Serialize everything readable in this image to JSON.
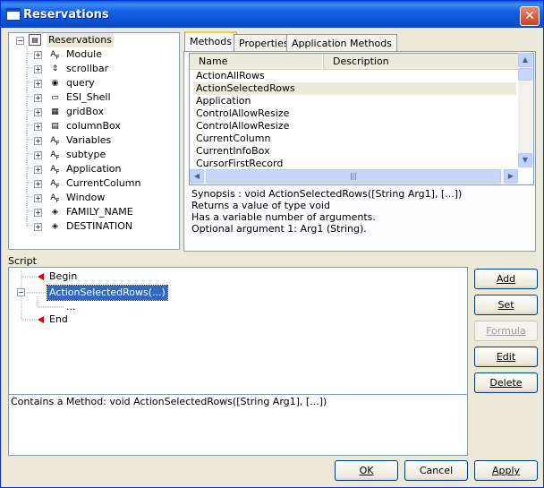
{
  "window": {
    "title": "Reservations",
    "close_glyph": "✕"
  },
  "tree": {
    "root": "Reservations",
    "items": [
      {
        "label": "Module",
        "icon": "af-icon"
      },
      {
        "label": "scrollbar",
        "icon": "scrollbar-icon"
      },
      {
        "label": "query",
        "icon": "query-icon"
      },
      {
        "label": "ESI_Shell",
        "icon": "shell-icon"
      },
      {
        "label": "gridBox",
        "icon": "grid-icon"
      },
      {
        "label": "columnBox",
        "icon": "column-icon"
      },
      {
        "label": "Variables",
        "icon": "af-icon"
      },
      {
        "label": "subtype",
        "icon": "af-icon"
      },
      {
        "label": "Application",
        "icon": "af-icon"
      },
      {
        "label": "CurrentColumn",
        "icon": "af-icon"
      },
      {
        "label": "Window",
        "icon": "af-icon"
      },
      {
        "label": "FAMILY_NAME",
        "icon": "field-icon"
      },
      {
        "label": "DESTINATION",
        "icon": "field-icon"
      }
    ]
  },
  "tabs": [
    "Methods",
    "Properties",
    "Application Methods"
  ],
  "list": {
    "headers": [
      "Name",
      "Description"
    ],
    "rows": [
      "ActionAllRows",
      "ActionSelectedRows",
      "Application",
      "ControlAllowResize",
      "ControlAllowResize",
      "CurrentColumn",
      "CurrentInfoBox",
      "CursorFirstRecord"
    ]
  },
  "synopsis": [
    "Synopsis : void ActionSelectedRows([String Arg1], [...])",
    "Returns a value of type void",
    "Has a variable number of arguments.",
    "Optional argument 1: Arg1 (String)."
  ],
  "script": {
    "label": "Script",
    "nodes": [
      "Begin",
      "ActionSelectedRows(...)",
      "...",
      "End"
    ],
    "description": "Contains a Method: void ActionSelectedRows([String Arg1], [...])"
  },
  "side_buttons": [
    "Add",
    "Set",
    "Formula",
    "Edit",
    "Delete"
  ],
  "bottom_buttons": [
    "OK",
    "Cancel",
    "Apply"
  ],
  "colors": {
    "title_bar": "#0a5fd9",
    "selection": "#316ac5",
    "marker": "#cc0000"
  }
}
